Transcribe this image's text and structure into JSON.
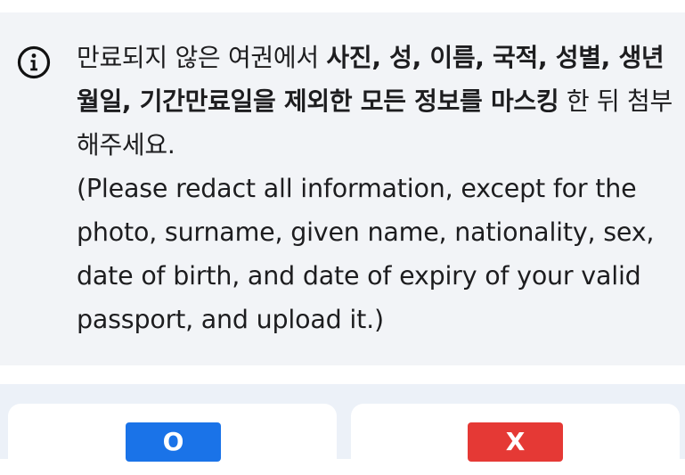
{
  "notice": {
    "ko_regular_1": "만료되지 않은 여권에서 ",
    "ko_bold": "사진, 성, 이름, 국적, 성별, 생년월일, 기간만료일을 제외한 모든 정보를 마스킹",
    "ko_regular_2": " 한 뒤 첨부해주세요.",
    "en": "(Please redact all information, except for the photo, surname, given name, nationality, sex, date of birth, and date of expiry of your valid passport, and upload it.)",
    "icon": "info-circle-icon"
  },
  "answers": {
    "o_label": "O",
    "x_label": "X"
  },
  "colors": {
    "notice_bg": "#f2f4f7",
    "o_button": "#1a73e8",
    "x_button": "#e53935"
  }
}
